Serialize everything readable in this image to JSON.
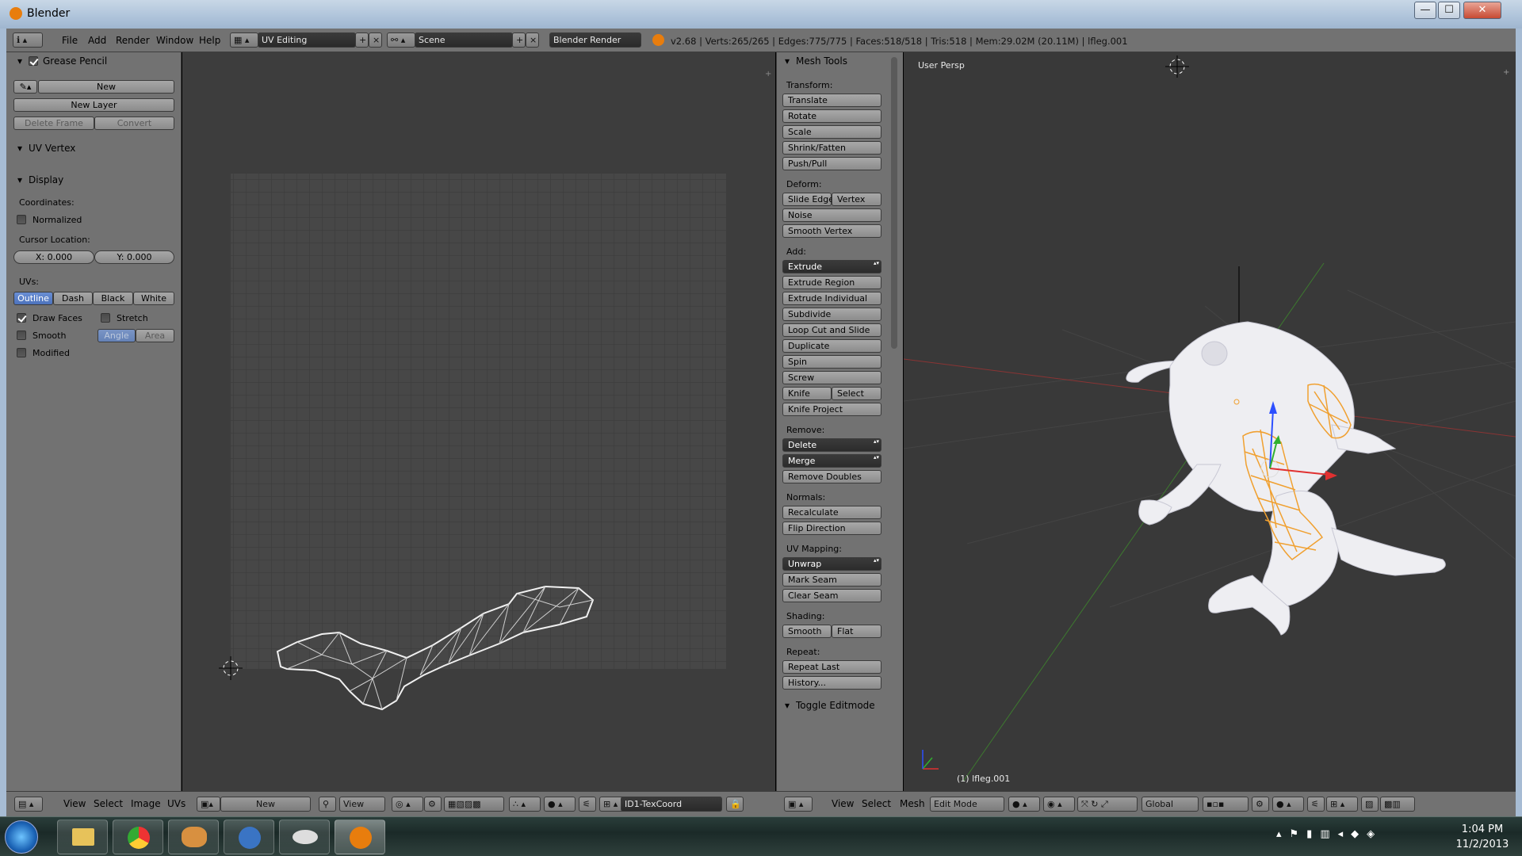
{
  "window": {
    "title": "Blender",
    "minimize": "—",
    "maximize": "☐",
    "close": "✕"
  },
  "header": {
    "menus": [
      "File",
      "Add",
      "Render",
      "Window",
      "Help"
    ],
    "layout": "UV Editing",
    "scene": "Scene",
    "engine": "Blender Render",
    "stats": "v2.68 | Verts:265/265 | Edges:775/775 | Faces:518/518 | Tris:518 | Mem:29.02M (20.11M) | lfleg.001"
  },
  "left_panel": {
    "grease_pencil": {
      "title": "Grease Pencil",
      "new": "New",
      "new_layer": "New Layer",
      "delete_frame": "Delete Frame",
      "convert": "Convert"
    },
    "uv_vertex": {
      "title": "UV Vertex"
    },
    "display": {
      "title": "Display",
      "coordinates": "Coordinates:",
      "normalized": "Normalized",
      "cursor_location": "Cursor Location:",
      "cursor_x": "X: 0.000",
      "cursor_y": "Y: 0.000",
      "uvs": "UVs:",
      "outline": "Outline",
      "dash": "Dash",
      "black": "Black",
      "white": "White",
      "draw_faces": "Draw Faces",
      "stretch": "Stretch",
      "smooth": "Smooth",
      "angle": "Angle",
      "area": "Area",
      "modified": "Modified"
    }
  },
  "uv_footer": {
    "menus": [
      "View",
      "Select",
      "Image",
      "UVs"
    ],
    "new": "New",
    "view": "View",
    "texcoord": "ID1-TexCoord"
  },
  "mesh_tools": {
    "title": "Mesh Tools",
    "transform_label": "Transform:",
    "translate": "Translate",
    "rotate": "Rotate",
    "scale": "Scale",
    "shrink_fatten": "Shrink/Fatten",
    "push_pull": "Push/Pull",
    "deform_label": "Deform:",
    "slide_edge": "Slide Edge",
    "vertex": "Vertex",
    "noise": "Noise",
    "smooth_vertex": "Smooth Vertex",
    "add_label": "Add:",
    "extrude": "Extrude",
    "extrude_region": "Extrude Region",
    "extrude_individual": "Extrude Individual",
    "subdivide": "Subdivide",
    "loop_cut_slide": "Loop Cut and Slide",
    "duplicate": "Duplicate",
    "spin": "Spin",
    "screw": "Screw",
    "knife": "Knife",
    "select": "Select",
    "knife_project": "Knife Project",
    "remove_label": "Remove:",
    "delete": "Delete",
    "merge": "Merge",
    "remove_doubles": "Remove Doubles",
    "normals_label": "Normals:",
    "recalculate": "Recalculate",
    "flip_direction": "Flip Direction",
    "uv_mapping_label": "UV Mapping:",
    "unwrap": "Unwrap",
    "mark_seam": "Mark Seam",
    "clear_seam": "Clear Seam",
    "shading_label": "Shading:",
    "smooth": "Smooth",
    "flat": "Flat",
    "repeat_label": "Repeat:",
    "repeat_last": "Repeat Last",
    "history": "History...",
    "toggle_editmode": "Toggle Editmode"
  },
  "viewport": {
    "label": "User Persp",
    "object": "(1) lfleg.001"
  },
  "view3d_footer": {
    "menus": [
      "View",
      "Select",
      "Mesh"
    ],
    "mode": "Edit Mode",
    "orientation": "Global"
  },
  "taskbar": {
    "time": "1:04 PM",
    "date": "11/2/2013"
  },
  "colors": {
    "selection_orange": "#f0a030",
    "button_blue": "#5680c2",
    "panel_gray": "#727272",
    "viewport_gray": "#393939"
  }
}
